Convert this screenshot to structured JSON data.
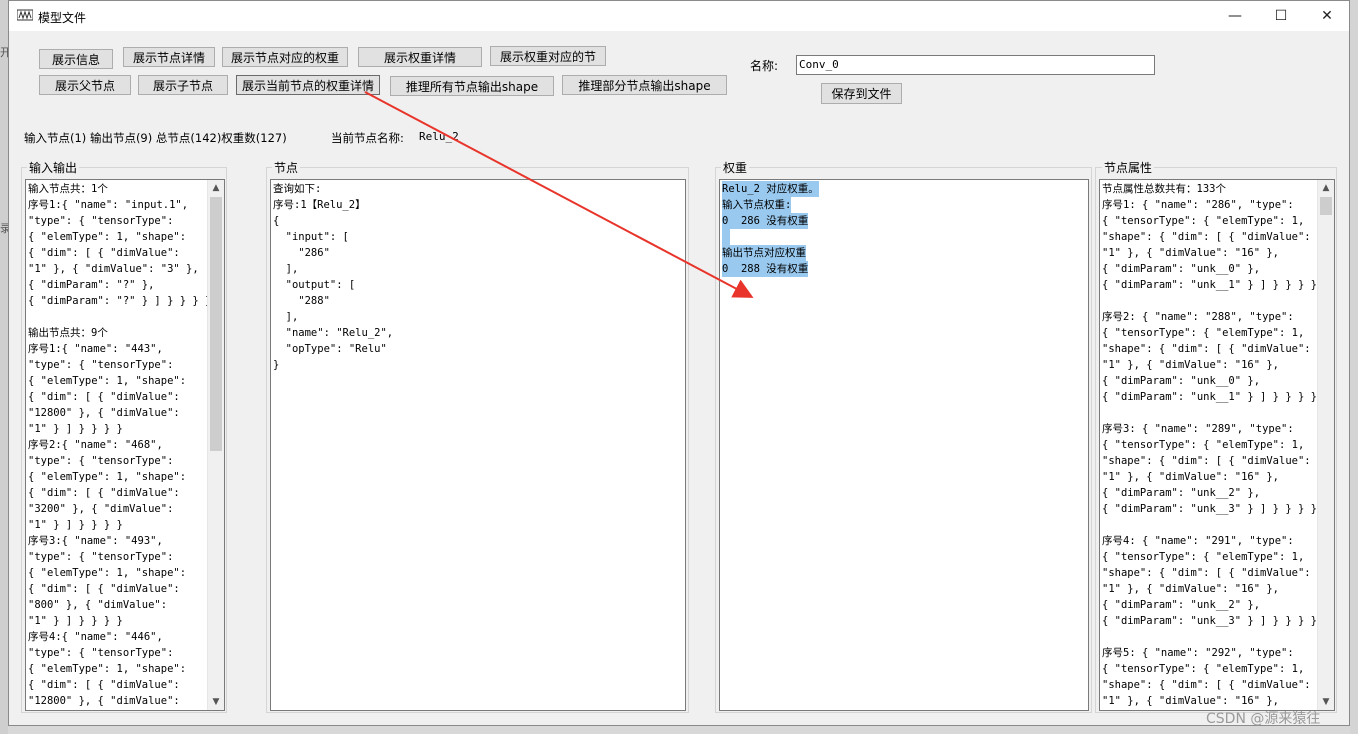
{
  "window": {
    "title": "模型文件",
    "controls": {
      "minimize": "—",
      "maximize": "☐",
      "close": "✕"
    }
  },
  "toolbar": {
    "row1": [
      "展示信息",
      "展示节点详情",
      "展示节点对应的权重",
      "展示权重详情",
      "展示权重对应的节"
    ],
    "row2": [
      "展示父节点",
      "展示子节点",
      "展示当前节点的权重详情",
      "推理所有节点输出shape",
      "推理部分节点输出shape"
    ]
  },
  "name_field": {
    "label": "名称:",
    "value": "Conv_0",
    "save_label": "保存到文件"
  },
  "status": {
    "summary": "输入节点(1) 输出节点(9) 总节点(142)权重数(127)",
    "current_label": "当前节点名称:",
    "current_value": "Relu_2"
  },
  "panels": {
    "io": {
      "title": "输入输出",
      "lines": [
        "输入节点共：1个",
        "序号1:{ \"name\": \"input.1\",",
        "\"type\": { \"tensorType\":",
        "{ \"elemType\": 1, \"shape\":",
        "{ \"dim\": [ { \"dimValue\":",
        "\"1\" }, { \"dimValue\": \"3\" },",
        "{ \"dimParam\": \"?\" },",
        "{ \"dimParam\": \"?\" } ] } } } }",
        "",
        "输出节点共：9个",
        "序号1:{ \"name\": \"443\",",
        "\"type\": { \"tensorType\":",
        "{ \"elemType\": 1, \"shape\":",
        "{ \"dim\": [ { \"dimValue\":",
        "\"12800\" }, { \"dimValue\":",
        "\"1\" } ] } } } }",
        "序号2:{ \"name\": \"468\",",
        "\"type\": { \"tensorType\":",
        "{ \"elemType\": 1, \"shape\":",
        "{ \"dim\": [ { \"dimValue\":",
        "\"3200\" }, { \"dimValue\":",
        "\"1\" } ] } } } }",
        "序号3:{ \"name\": \"493\",",
        "\"type\": { \"tensorType\":",
        "{ \"elemType\": 1, \"shape\":",
        "{ \"dim\": [ { \"dimValue\":",
        "\"800\" }, { \"dimValue\":",
        "\"1\" } ] } } } }",
        "序号4:{ \"name\": \"446\",",
        "\"type\": { \"tensorType\":",
        "{ \"elemType\": 1, \"shape\":",
        "{ \"dim\": [ { \"dimValue\":",
        "\"12800\" }, { \"dimValue\":"
      ],
      "scroll_position": 0.0
    },
    "node": {
      "title": "节点",
      "lines": [
        "查询如下:",
        "序号:1【Relu_2】",
        "{",
        "  \"input\": [",
        "    \"286\"",
        "  ],",
        "  \"output\": [",
        "    \"288\"",
        "  ],",
        "  \"name\": \"Relu_2\",",
        "  \"opType\": \"Relu\"",
        "}"
      ]
    },
    "weights": {
      "title": "权重",
      "lines": [
        "Relu_2 对应权重。",
        "输入节点权重:",
        "0  286 没有权重",
        " ",
        "输出节点对应权重",
        "0  288 没有权重"
      ]
    },
    "attrs": {
      "title": "节点属性",
      "lines": [
        "节点属性总数共有：133个",
        "序号1: { \"name\": \"286\", \"type\":",
        "{ \"tensorType\": { \"elemType\": 1,",
        "\"shape\": { \"dim\": [ { \"dimValue\":",
        "\"1\" }, { \"dimValue\": \"16\" },",
        "{ \"dimParam\": \"unk__0\" },",
        "{ \"dimParam\": \"unk__1\" } ] } } } }",
        "",
        "序号2: { \"name\": \"288\", \"type\":",
        "{ \"tensorType\": { \"elemType\": 1,",
        "\"shape\": { \"dim\": [ { \"dimValue\":",
        "\"1\" }, { \"dimValue\": \"16\" },",
        "{ \"dimParam\": \"unk__0\" },",
        "{ \"dimParam\": \"unk__1\" } ] } } } }",
        "",
        "序号3: { \"name\": \"289\", \"type\":",
        "{ \"tensorType\": { \"elemType\": 1,",
        "\"shape\": { \"dim\": [ { \"dimValue\":",
        "\"1\" }, { \"dimValue\": \"16\" },",
        "{ \"dimParam\": \"unk__2\" },",
        "{ \"dimParam\": \"unk__3\" } ] } } } }",
        "",
        "序号4: { \"name\": \"291\", \"type\":",
        "{ \"tensorType\": { \"elemType\": 1,",
        "\"shape\": { \"dim\": [ { \"dimValue\":",
        "\"1\" }, { \"dimValue\": \"16\" },",
        "{ \"dimParam\": \"unk__2\" },",
        "{ \"dimParam\": \"unk__3\" } ] } } } }",
        "",
        "序号5: { \"name\": \"292\", \"type\":",
        "{ \"tensorType\": { \"elemType\": 1,",
        "\"shape\": { \"dim\": [ { \"dimValue\":",
        "\"1\" }, { \"dimValue\": \"16\" },"
      ],
      "scroll_position": 0.0
    }
  },
  "annotation": {
    "color": "#e8342a"
  },
  "watermark": "CSDN @源来猿往",
  "desktop_fragments": [
    "开",
    "录"
  ],
  "colors": {
    "selection": "#99c9ef",
    "window_bg": "#f0f0f0"
  }
}
